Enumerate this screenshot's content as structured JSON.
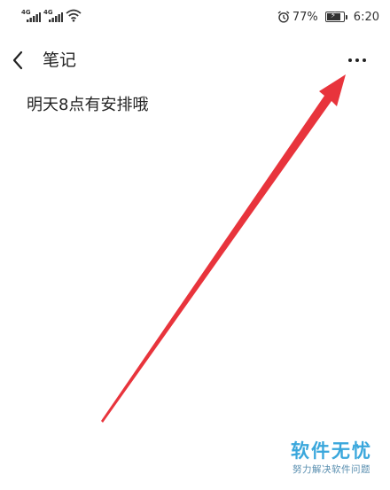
{
  "status_bar": {
    "network_1": "4G",
    "network_2": "4G",
    "battery_percent": "77%",
    "battery_level": 0.77,
    "battery_charging": true,
    "time": "6:20",
    "icons": [
      "signal-icon",
      "signal-icon",
      "wifi-icon",
      "alarm-icon",
      "battery-icon"
    ]
  },
  "app_bar": {
    "back_icon": "chevron-left-icon",
    "title": "笔记",
    "more_icon": "more-horizontal-icon"
  },
  "note": {
    "content": "明天8点有安排哦"
  },
  "annotation": {
    "color": "#e8343c",
    "icon": "arrow-icon"
  },
  "watermark": {
    "title": "软件无忧",
    "subtitle": "努力解决软件问题",
    "color": "#3aa7dc"
  }
}
